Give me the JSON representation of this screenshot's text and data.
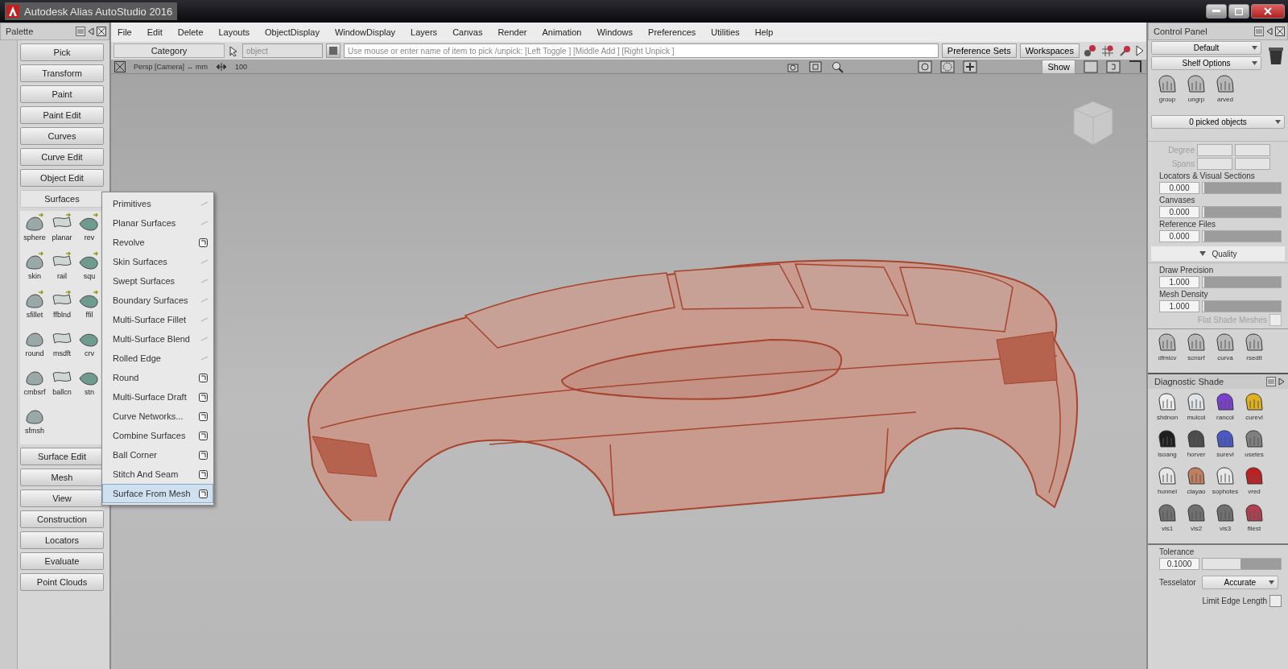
{
  "window": {
    "title": "Autodesk Alias AutoStudio 2016"
  },
  "palette": {
    "title": "Palette",
    "sections": [
      {
        "label": "Pick",
        "expanded": false
      },
      {
        "label": "Transform",
        "expanded": false
      },
      {
        "label": "Paint",
        "expanded": false
      },
      {
        "label": "Paint Edit",
        "expanded": false
      },
      {
        "label": "Curves",
        "expanded": false
      },
      {
        "label": "Curve Edit",
        "expanded": false
      },
      {
        "label": "Object Edit",
        "expanded": false
      },
      {
        "label": "Surfaces",
        "expanded": true,
        "tools": [
          {
            "label": "sphere"
          },
          {
            "label": "planar"
          },
          {
            "label": "rev"
          },
          {
            "label": "skin"
          },
          {
            "label": "rail"
          },
          {
            "label": "squ"
          },
          {
            "label": "sfillet"
          },
          {
            "label": "ffblnd"
          },
          {
            "label": "ffil"
          },
          {
            "label": "round"
          },
          {
            "label": "msdft"
          },
          {
            "label": "crv"
          },
          {
            "label": "cmbsrf"
          },
          {
            "label": "ballcn"
          },
          {
            "label": "stn"
          },
          {
            "label": "sfmsh"
          }
        ]
      },
      {
        "label": "Surface Edit",
        "expanded": false
      },
      {
        "label": "Mesh",
        "expanded": false
      },
      {
        "label": "View",
        "expanded": false
      },
      {
        "label": "Construction",
        "expanded": false
      },
      {
        "label": "Locators",
        "expanded": false
      },
      {
        "label": "Evaluate",
        "expanded": false
      },
      {
        "label": "Point Clouds",
        "expanded": false
      }
    ]
  },
  "menu_bar": [
    "File",
    "Edit",
    "Delete",
    "Layouts",
    "ObjectDisplay",
    "WindowDisplay",
    "Layers",
    "Canvas",
    "Render",
    "Animation",
    "Windows",
    "Preferences",
    "Utilities",
    "Help"
  ],
  "toolbar": {
    "category": "Category",
    "object_placeholder": "object",
    "prompt_placeholder": "Use mouse or enter name of item to pick /unpick: [Left Toggle ] [Middle Add ] [Right Unpick ]",
    "buttons": [
      "Preference Sets",
      "Workspaces"
    ]
  },
  "view_bar": {
    "camera": "Persp [Camera] ↔ mm",
    "zoom": "100",
    "show_button": "Show"
  },
  "surfaces_menu": [
    {
      "label": "Primitives",
      "kind": "submenu",
      "selected": false
    },
    {
      "label": "Planar Surfaces",
      "kind": "submenu",
      "selected": false
    },
    {
      "label": "Revolve",
      "kind": "option",
      "selected": false
    },
    {
      "label": "Skin Surfaces",
      "kind": "submenu",
      "selected": false
    },
    {
      "label": "Swept Surfaces",
      "kind": "submenu",
      "selected": false
    },
    {
      "label": "Boundary Surfaces",
      "kind": "submenu",
      "selected": false
    },
    {
      "label": "Multi-Surface Fillet",
      "kind": "submenu",
      "selected": false
    },
    {
      "label": "Multi-Surface Blend",
      "kind": "submenu",
      "selected": false
    },
    {
      "label": "Rolled Edge",
      "kind": "submenu",
      "selected": false
    },
    {
      "label": "Round",
      "kind": "option",
      "selected": false
    },
    {
      "label": "Multi-Surface Draft",
      "kind": "option",
      "selected": false
    },
    {
      "label": "Curve Networks...",
      "kind": "option",
      "selected": false
    },
    {
      "label": "Combine Surfaces",
      "kind": "option",
      "selected": false
    },
    {
      "label": "Ball Corner",
      "kind": "option",
      "selected": false
    },
    {
      "label": "Stitch And Seam",
      "kind": "option",
      "selected": false
    },
    {
      "label": "Surface From Mesh",
      "kind": "option",
      "selected": true
    }
  ],
  "control_panel": {
    "title": "Control Panel",
    "preset": "Default",
    "shelf_options": "Shelf Options",
    "shelf": [
      {
        "label": "group"
      },
      {
        "label": "ungrp"
      },
      {
        "label": "arved"
      }
    ],
    "picked": "0 picked objects",
    "degree_label": "Degree",
    "spans_label": "Spans",
    "sliders": [
      {
        "label": "Locators & Visual Sections",
        "value": "0.000",
        "level": 0.02
      },
      {
        "label": "Canvases",
        "value": "0.000",
        "level": 0.02
      },
      {
        "label": "Reference Files",
        "value": "0.000",
        "level": 0.02
      }
    ],
    "quality": {
      "title": "Quality",
      "sliders": [
        {
          "label": "Draw Precision",
          "value": "1.000",
          "level": 0.02
        },
        {
          "label": "Mesh Density",
          "value": "1.000",
          "level": 0.02
        }
      ],
      "flat_shade": {
        "label": "Flat Shade Meshes",
        "checked": false,
        "disabled": true
      }
    },
    "shelf2": [
      {
        "label": "dfmicv"
      },
      {
        "label": "scnsrf"
      },
      {
        "label": "curva"
      },
      {
        "label": "rsedit"
      }
    ],
    "diagnostic": {
      "title": "Diagnostic Shade",
      "tools": [
        {
          "label": "shdnon",
          "color": "#eeeeee"
        },
        {
          "label": "mulcol",
          "color": "#dde4ea"
        },
        {
          "label": "rancol",
          "color": "#7b3fd0"
        },
        {
          "label": "curevl",
          "color": "#e0b020"
        },
        {
          "label": "isoang",
          "color": "#1e1e1e"
        },
        {
          "label": "horver",
          "color": "#4c4c4c"
        },
        {
          "label": "surevl",
          "color": "#4a58c8"
        },
        {
          "label": "usetes",
          "color": "#808080"
        },
        {
          "label": "hunnel",
          "color": "#e6e6e6"
        },
        {
          "label": "clayao",
          "color": "#c08060"
        },
        {
          "label": "sophotes",
          "color": "#e8e8e8"
        },
        {
          "label": "vred",
          "color": "#c02020"
        },
        {
          "label": "vis1",
          "color": "#707070"
        },
        {
          "label": "vis2",
          "color": "#707070"
        },
        {
          "label": "vis3",
          "color": "#707070"
        },
        {
          "label": "filest",
          "color": "#b04050"
        }
      ]
    },
    "tolerance": {
      "label": "Tolerance",
      "value": "0.1000",
      "level": 0.48
    },
    "tesselator": {
      "label": "Tesselator",
      "value": "Accurate"
    },
    "limit_edge": {
      "label": "Limit Edge Length",
      "checked": false
    }
  }
}
